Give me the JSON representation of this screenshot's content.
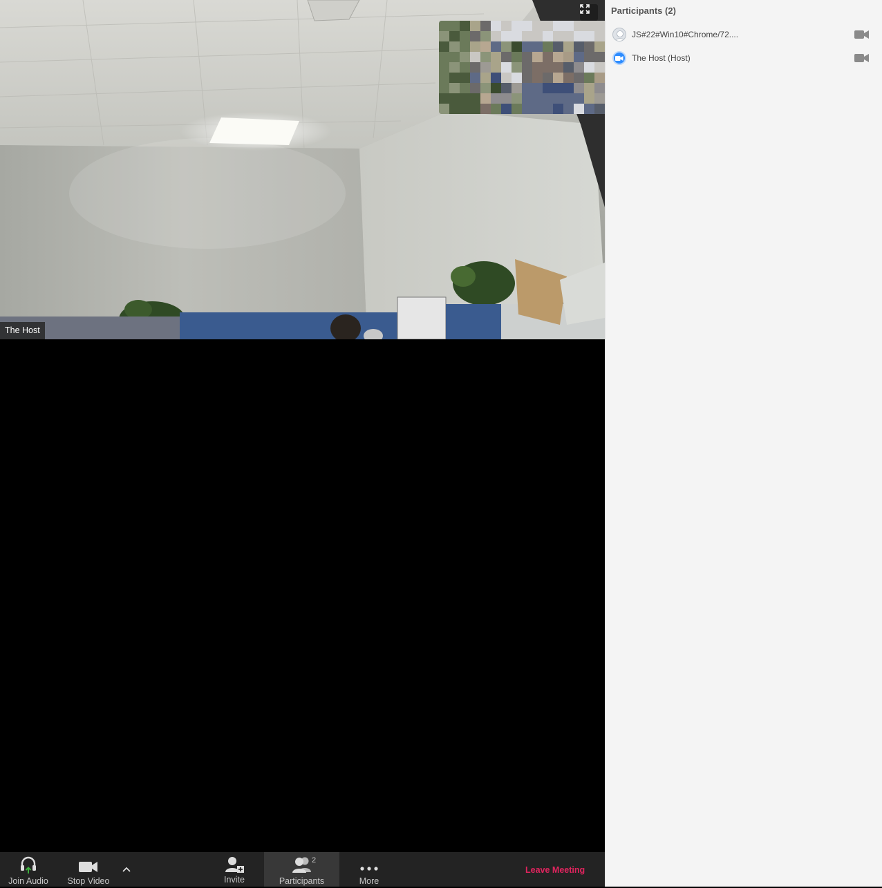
{
  "video": {
    "speaker_name": "The Host",
    "fullscreen_icon": "fullscreen-icon"
  },
  "toolbar": {
    "join_audio_label": "Join Audio",
    "stop_video_label": "Stop Video",
    "invite_label": "Invite",
    "participants_label": "Participants",
    "participants_count": "2",
    "more_label": "More",
    "leave_label": "Leave Meeting",
    "accent_color": "#e0245e",
    "audio_arrow_color": "#3db13d"
  },
  "panel": {
    "title": "Participants (2)",
    "participants": [
      {
        "name": "JS#22#Win10#Chrome/72....",
        "avatar": "default-avatar-icon",
        "video_icon": "video-camera-icon"
      },
      {
        "name": "The Host (Host)",
        "avatar": "zoom-avatar-icon",
        "video_icon": "video-camera-icon"
      }
    ]
  }
}
